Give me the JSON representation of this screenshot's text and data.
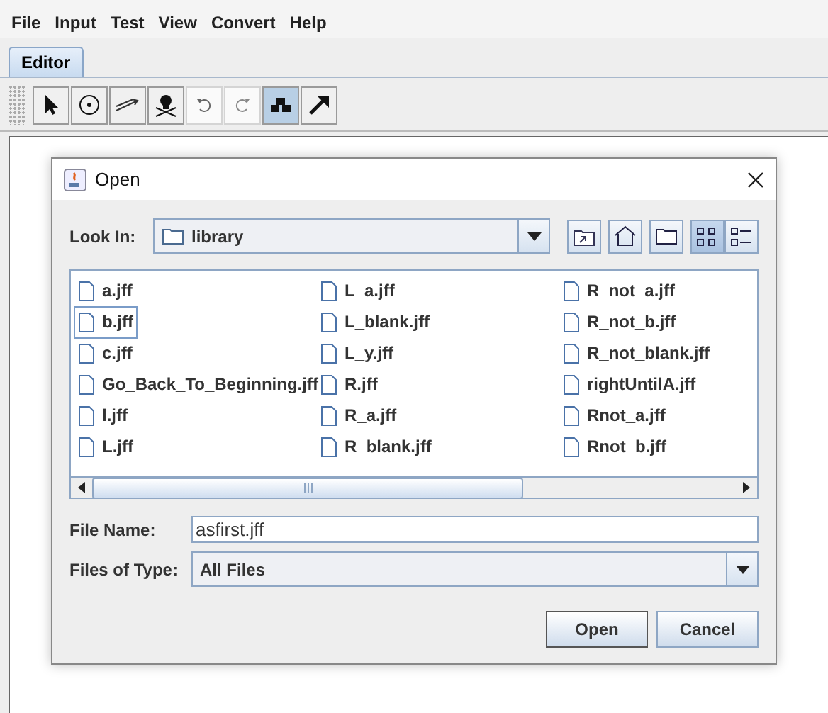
{
  "menu": [
    "File",
    "Input",
    "Test",
    "View",
    "Convert",
    "Help"
  ],
  "tabs": [
    {
      "label": "Editor",
      "selected": true
    }
  ],
  "tools": [
    {
      "kind": "pointer",
      "selected": false,
      "disabled": false
    },
    {
      "kind": "state",
      "selected": false,
      "disabled": false
    },
    {
      "kind": "transition",
      "selected": false,
      "disabled": false
    },
    {
      "kind": "delete",
      "selected": false,
      "disabled": false
    },
    {
      "kind": "undo",
      "selected": false,
      "disabled": true
    },
    {
      "kind": "redo",
      "selected": false,
      "disabled": true
    },
    {
      "kind": "layout",
      "selected": true,
      "disabled": false
    },
    {
      "kind": "build",
      "selected": false,
      "disabled": false
    }
  ],
  "dialog": {
    "title": "Open",
    "look_in": {
      "label": "Look In:",
      "value": "library"
    },
    "view_buttons": [
      {
        "kind": "up",
        "selected": false
      },
      {
        "kind": "home",
        "selected": false
      },
      {
        "kind": "newfolder",
        "selected": false
      },
      {
        "kind": "list",
        "selected": true
      },
      {
        "kind": "details",
        "selected": false
      }
    ],
    "files": [
      {
        "name": "a.jff",
        "focused": false
      },
      {
        "name": "b.jff",
        "focused": true
      },
      {
        "name": "c.jff",
        "focused": false
      },
      {
        "name": "Go_Back_To_Beginning.jff",
        "focused": false
      },
      {
        "name": "l.jff",
        "focused": false
      },
      {
        "name": "L.jff",
        "focused": false
      },
      {
        "name": "L_a.jff",
        "focused": false
      },
      {
        "name": "L_blank.jff",
        "focused": false
      },
      {
        "name": "L_y.jff",
        "focused": false
      },
      {
        "name": "R.jff",
        "focused": false
      },
      {
        "name": "R_a.jff",
        "focused": false
      },
      {
        "name": "R_blank.jff",
        "focused": false
      },
      {
        "name": "R_not_a.jff",
        "focused": false
      },
      {
        "name": "R_not_b.jff",
        "focused": false
      },
      {
        "name": "R_not_blank.jff",
        "focused": false
      },
      {
        "name": "rightUntilA.jff",
        "focused": false
      },
      {
        "name": "Rnot_a.jff",
        "focused": false
      },
      {
        "name": "Rnot_b.jff",
        "focused": false
      }
    ],
    "file_name": {
      "label": "File Name:",
      "value": "asfirst.jff"
    },
    "file_type": {
      "label": "Files of Type:",
      "value": "All Files"
    },
    "buttons": [
      "Open",
      "Cancel"
    ]
  }
}
